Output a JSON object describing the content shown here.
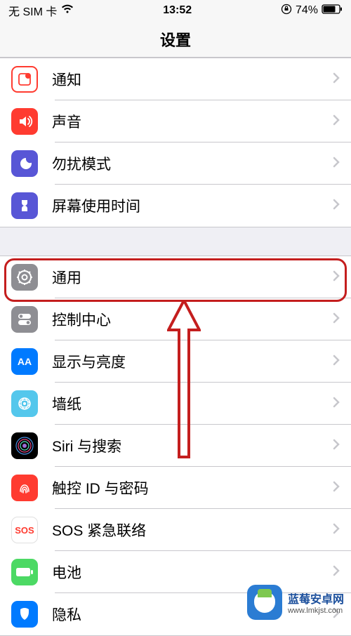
{
  "status": {
    "carrier": "无 SIM 卡",
    "time": "13:52",
    "battery": "74%"
  },
  "header": {
    "title": "设置"
  },
  "group1": [
    {
      "label": "通知"
    },
    {
      "label": "声音"
    },
    {
      "label": "勿扰模式"
    },
    {
      "label": "屏幕使用时间"
    }
  ],
  "group2": [
    {
      "label": "通用"
    },
    {
      "label": "控制中心"
    },
    {
      "label": "显示与亮度"
    },
    {
      "label": "墙纸"
    },
    {
      "label": "Siri 与搜索"
    },
    {
      "label": "触控 ID 与密码"
    },
    {
      "label": "SOS 紧急联络",
      "badge": "SOS"
    },
    {
      "label": "电池"
    },
    {
      "label": "隐私"
    }
  ],
  "watermark": {
    "title": "蓝莓安卓网",
    "url": "www.lmkjst.com"
  },
  "annotation": {
    "highlight_target": "通用",
    "arrow_points_to": "通用"
  },
  "icon_text": {
    "aa": "AA",
    "sos": "SOS"
  }
}
